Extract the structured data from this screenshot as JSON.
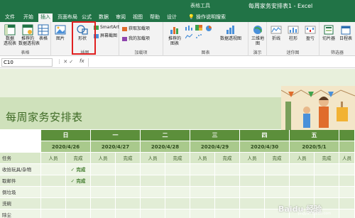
{
  "window": {
    "context_label": "表格工具",
    "title": "每周家务安排表1 - Excel"
  },
  "tabs": [
    {
      "label": "文件"
    },
    {
      "label": "开始"
    },
    {
      "label": "插入",
      "active": true
    },
    {
      "label": "页面布局"
    },
    {
      "label": "公式"
    },
    {
      "label": "数据"
    },
    {
      "label": "审阅"
    },
    {
      "label": "视图"
    },
    {
      "label": "帮助"
    },
    {
      "label": "设计"
    },
    {
      "label": "操作说明搜索"
    }
  ],
  "ribbon": {
    "tables": {
      "pivot": "数据\n透视表",
      "recommended_pivot": "推荐的\n数据透视表",
      "table": "表格",
      "group": "表格"
    },
    "illustrations": {
      "pictures": "图片",
      "shapes": "形状",
      "smartart": "SmartArt",
      "screenshot": "屏幕截图",
      "group": "插图"
    },
    "addins": {
      "get": "获取加载项",
      "mine": "我的加载项",
      "group": "加载项"
    },
    "charts": {
      "recommended": "推荐的\n图表",
      "pivotchart": "数据透视图",
      "group": "图表"
    },
    "tours": {
      "map3d": "三维地\n图",
      "group": "演示"
    },
    "sparklines": {
      "line": "折线",
      "column": "柱形",
      "winloss": "盈亏",
      "group": "迷你图"
    },
    "filters": {
      "slicer": "切片器",
      "timeline": "日程表",
      "group": "筛选器"
    }
  },
  "formula_bar": {
    "name_box": "C10",
    "fx": "fx",
    "value": ""
  },
  "sheet": {
    "title": "每周家务安排表",
    "task_header": "任务",
    "sub_headers": {
      "person": "人员",
      "done": "完成"
    },
    "days": [
      {
        "day": "日",
        "date": "2020/4/26"
      },
      {
        "day": "一",
        "date": "2020/4/27"
      },
      {
        "day": "二",
        "date": "2020/4/28"
      },
      {
        "day": "三",
        "date": "2020/4/29"
      },
      {
        "day": "四",
        "date": "2020/4/30"
      },
      {
        "day": "五",
        "date": "2020/5/1"
      }
    ],
    "tasks": [
      {
        "name": "收拾玩具/杂物",
        "sun_done": "✓ 完成"
      },
      {
        "name": "取邮件",
        "sun_done": "✓ 完成"
      },
      {
        "name": "倒垃圾",
        "sun_done": ""
      },
      {
        "name": "洗碗",
        "sun_done": ""
      },
      {
        "name": "除尘",
        "sun_done": ""
      }
    ]
  },
  "watermark": {
    "text": "Baidu 经验",
    "url": "jingyan.baidu.com"
  },
  "colors": {
    "excel_green": "#217346",
    "header_dark": "#5c8f3b",
    "header_mid": "#a9c98c",
    "accent_red": "#e02020"
  }
}
